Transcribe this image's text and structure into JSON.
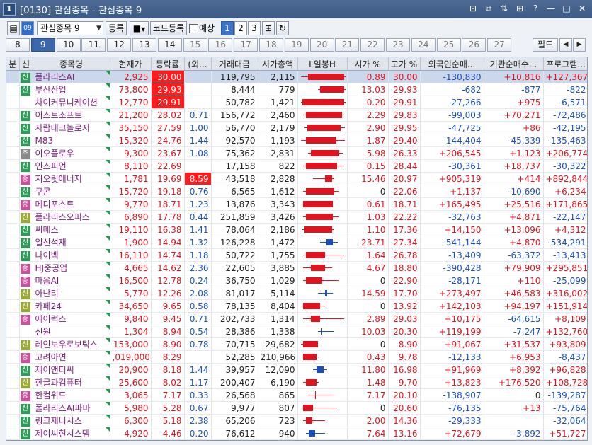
{
  "window": {
    "app_icon": "1",
    "title": "[0130] 관심종목 - 관심종목 9",
    "title_icons": [
      "link-icon",
      "copy-icon",
      "sort-icon",
      "grid-icon",
      "help-icon",
      "minimize-icon",
      "maximize-icon",
      "close-icon"
    ],
    "title_glyphs": [
      "⊡",
      "⧉",
      "⇅",
      "⊞",
      "?",
      "—",
      "□",
      "✕"
    ]
  },
  "toolbar": {
    "group_select": "관심종목 9",
    "register_btn": "등록",
    "code_register_btn": "코드등록",
    "forecast_label": "예상",
    "pages": [
      "1",
      "2",
      "3"
    ],
    "active_page": "1"
  },
  "tabs": {
    "items": [
      "8",
      "9",
      "10",
      "11",
      "12",
      "13",
      "14",
      "15",
      "16",
      "17",
      "18",
      "19",
      "20",
      "21",
      "22",
      "23",
      "24",
      "25",
      "26",
      "27"
    ],
    "active": "9",
    "dim_from": 7,
    "filter_btn": "필드",
    "prev": "◀",
    "next": "▶"
  },
  "headers": [
    "분",
    "신",
    "종목명",
    "현재가",
    "등락률",
    "(외...",
    "거래대금",
    "시가총액",
    "L일봉H",
    "시가 %",
    "고가 %",
    "외국인순매...",
    "기관순매수...",
    "프로그램..."
  ],
  "rows": [
    {
      "badge": "신",
      "bc": "b-green",
      "name": "폴라리스AI",
      "price": "2,925",
      "pc": "up",
      "rate": "30.00",
      "rc": "up",
      "rhl": true,
      "fr": "",
      "vol": "119,795",
      "cap": "2,115",
      "open": "0.89",
      "oc": "up",
      "high": "30.00",
      "hc": "up",
      "frg": "-130,830",
      "fc": "dn",
      "ins": "+10,816",
      "ic": "up",
      "prg": "+127,367",
      "gc": "up",
      "sel": true,
      "cdl": {
        "type": "up",
        "lo": 0.05,
        "o": 0.2,
        "c": 0.95,
        "hi": 0.98
      }
    },
    {
      "badge": "신",
      "bc": "b-green",
      "name": "부산산업",
      "price": "73,800",
      "pc": "up",
      "rate": "29.93",
      "rc": "up",
      "rhl": true,
      "fr": "",
      "vol": "8,444",
      "cap": "779",
      "open": "13.03",
      "oc": "up",
      "high": "29.93",
      "hc": "up",
      "frg": "-682",
      "fc": "dn",
      "ins": "-877",
      "ic": "dn",
      "prg": "-822",
      "gc": "dn",
      "cdl": {
        "type": "up",
        "lo": 0.4,
        "o": 0.45,
        "c": 0.95,
        "hi": 0.98
      }
    },
    {
      "badge": "",
      "bc": "",
      "name": "차이커뮤니케이션",
      "price": "12,770",
      "pc": "up",
      "rate": "29.91",
      "rc": "up",
      "rhl": true,
      "fr": "",
      "vol": "50,782",
      "cap": "1,421",
      "open": "0.20",
      "oc": "up",
      "high": "29.91",
      "hc": "up",
      "frg": "-27,266",
      "fc": "dn",
      "ins": "+975",
      "ic": "up",
      "prg": "-6,571",
      "gc": "dn",
      "cdl": {
        "type": "up",
        "lo": 0.05,
        "o": 0.08,
        "c": 0.95,
        "hi": 0.98
      }
    },
    {
      "badge": "신",
      "bc": "b-green",
      "name": "이스트소프트",
      "price": "21,200",
      "pc": "up",
      "rate": "28.02",
      "rc": "up",
      "fr": "0.71",
      "vol": "156,772",
      "cap": "2,460",
      "open": "2.29",
      "oc": "up",
      "high": "29.83",
      "hc": "up",
      "frg": "-99,003",
      "fc": "dn",
      "ins": "+70,271",
      "ic": "up",
      "prg": "-72,486",
      "gc": "dn",
      "cdl": {
        "type": "up",
        "lo": 0.1,
        "o": 0.15,
        "c": 0.9,
        "hi": 0.97
      }
    },
    {
      "badge": "신",
      "bc": "b-green",
      "name": "자람테크놀로지",
      "price": "35,150",
      "pc": "up",
      "rate": "27.59",
      "rc": "up",
      "fr": "1.00",
      "vol": "56,770",
      "cap": "2,179",
      "open": "2.90",
      "oc": "up",
      "high": "29.95",
      "hc": "up",
      "frg": "-47,725",
      "fc": "dn",
      "ins": "+86",
      "ic": "up",
      "prg": "-42,195",
      "gc": "dn",
      "cdl": {
        "type": "up",
        "lo": 0.12,
        "o": 0.18,
        "c": 0.88,
        "hi": 0.97
      }
    },
    {
      "badge": "신",
      "bc": "b-green",
      "name": "M83",
      "price": "15,320",
      "pc": "up",
      "rate": "24.76",
      "rc": "up",
      "fr": "1.44",
      "vol": "92,570",
      "cap": "1,193",
      "open": "1.87",
      "oc": "up",
      "high": "29.40",
      "hc": "up",
      "frg": "-144,404",
      "fc": "dn",
      "ins": "-45,339",
      "ic": "dn",
      "prg": "-135,463",
      "gc": "dn",
      "cdl": {
        "type": "up",
        "lo": 0.05,
        "o": 0.15,
        "c": 0.78,
        "hi": 0.96
      }
    },
    {
      "badge": "주",
      "bc": "b-gray",
      "name": "이오플로우",
      "price": "9,300",
      "pc": "up",
      "rate": "23.67",
      "rc": "up",
      "fr": "1.08",
      "vol": "75,362",
      "cap": "2,831",
      "open": "5.98",
      "oc": "up",
      "high": "26.33",
      "hc": "up",
      "frg": "+206,545",
      "fc": "up",
      "ins": "+1,123",
      "ic": "up",
      "prg": "+206,774",
      "gc": "up",
      "cdl": {
        "type": "up",
        "lo": 0.2,
        "o": 0.25,
        "c": 0.85,
        "hi": 0.92
      }
    },
    {
      "badge": "신",
      "bc": "b-green",
      "name": "인스피언",
      "price": "8,110",
      "pc": "up",
      "rate": "22.69",
      "rc": "up",
      "fr": "",
      "vol": "17,158",
      "cap": "822",
      "open": "0.15",
      "oc": "up",
      "high": "28.44",
      "hc": "up",
      "frg": "-30,361",
      "fc": "dn",
      "ins": "+18,737",
      "ic": "up",
      "prg": "-30,322",
      "gc": "dn",
      "cdl": {
        "type": "up",
        "lo": 0.1,
        "o": 0.15,
        "c": 0.8,
        "hi": 0.95
      }
    },
    {
      "badge": "증",
      "bc": "b-pink",
      "name": "지오릿에너지",
      "price": "1,781",
      "pc": "up",
      "rate": "19.69",
      "rc": "up",
      "fr": "8.59",
      "frhl": true,
      "vol": "43,518",
      "cap": "2,828",
      "open": "15.46",
      "oc": "up",
      "high": "20.97",
      "hc": "up",
      "frg": "+905,319",
      "fc": "up",
      "ins": "+414",
      "ic": "up",
      "prg": "+892,844",
      "gc": "up",
      "cdl": {
        "type": "up",
        "lo": 0.3,
        "o": 0.55,
        "c": 0.7,
        "hi": 0.75
      }
    },
    {
      "badge": "신",
      "bc": "b-green",
      "name": "쿠콘",
      "price": "15,720",
      "pc": "up",
      "rate": "19.18",
      "rc": "up",
      "fr": "0.76",
      "vol": "6,565",
      "cap": "1,612",
      "open": "0",
      "oc": "blk",
      "high": "22.06",
      "hc": "up",
      "frg": "+1,137",
      "fc": "up",
      "ins": "-10,690",
      "ic": "dn",
      "prg": "+6,234",
      "gc": "up",
      "cdl": {
        "type": "up",
        "lo": 0.1,
        "o": 0.15,
        "c": 0.75,
        "hi": 0.85
      }
    },
    {
      "badge": "증",
      "bc": "b-pink",
      "name": "메디포스트",
      "price": "9,770",
      "pc": "up",
      "rate": "18.71",
      "rc": "up",
      "fr": "1.23",
      "vol": "13,876",
      "cap": "3,343",
      "open": "0.61",
      "oc": "up",
      "high": "18.71",
      "hc": "up",
      "frg": "+165,495",
      "fc": "up",
      "ins": "+25,516",
      "ic": "up",
      "prg": "+171,865",
      "gc": "up",
      "cdl": {
        "type": "up",
        "lo": 0.05,
        "o": 0.1,
        "c": 0.72,
        "hi": 0.72
      }
    },
    {
      "badge": "신",
      "bc": "b-olive",
      "name": "폴라리스오피스",
      "price": "6,890",
      "pc": "up",
      "rate": "17.78",
      "rc": "up",
      "fr": "0.44",
      "vol": "251,859",
      "cap": "3,426",
      "open": "1.03",
      "oc": "up",
      "high": "22.22",
      "hc": "up",
      "frg": "-32,763",
      "fc": "dn",
      "ins": "+4,871",
      "ic": "up",
      "prg": "-22,147",
      "gc": "dn",
      "cdl": {
        "type": "up",
        "lo": 0.1,
        "o": 0.15,
        "c": 0.72,
        "hi": 0.85
      }
    },
    {
      "badge": "신",
      "bc": "b-green",
      "name": "씨메스",
      "price": "19,110",
      "pc": "up",
      "rate": "16.38",
      "rc": "up",
      "fr": "1.41",
      "vol": "78,064",
      "cap": "2,186",
      "open": "1.10",
      "oc": "up",
      "high": "17.36",
      "hc": "up",
      "frg": "+14,150",
      "fc": "up",
      "ins": "+13,096",
      "ic": "up",
      "prg": "+4,312",
      "gc": "up",
      "cdl": {
        "type": "up",
        "lo": 0.08,
        "o": 0.12,
        "c": 0.7,
        "hi": 0.75
      }
    },
    {
      "badge": "신",
      "bc": "b-green",
      "name": "일신석재",
      "price": "1,900",
      "pc": "up",
      "rate": "14.94",
      "rc": "up",
      "fr": "1.32",
      "vol": "126,228",
      "cap": "1,472",
      "open": "23.71",
      "oc": "up",
      "high": "27.34",
      "hc": "up",
      "frg": "-541,144",
      "fc": "dn",
      "ins": "+4,870",
      "ic": "up",
      "prg": "-534,291",
      "gc": "dn",
      "cdl": {
        "type": "dn",
        "lo": 0.45,
        "o": 0.72,
        "c": 0.58,
        "hi": 0.82
      }
    },
    {
      "badge": "신",
      "bc": "b-green",
      "name": "나이벡",
      "price": "16,110",
      "pc": "up",
      "rate": "14.74",
      "rc": "up",
      "fr": "1.18",
      "vol": "50,722",
      "cap": "1,755",
      "open": "1.64",
      "oc": "up",
      "high": "26.78",
      "hc": "up",
      "frg": "-13,409",
      "fc": "dn",
      "ins": "-63,372",
      "ic": "dn",
      "prg": "-13,413",
      "gc": "dn",
      "cdl": {
        "type": "up",
        "lo": 0.1,
        "o": 0.15,
        "c": 0.55,
        "hi": 0.95
      }
    },
    {
      "badge": "증",
      "bc": "b-pink",
      "name": "HJ중공업",
      "price": "4,665",
      "pc": "up",
      "rate": "14.62",
      "rc": "up",
      "fr": "2.36",
      "vol": "22,605",
      "cap": "3,885",
      "open": "4.67",
      "oc": "up",
      "high": "18.80",
      "hc": "up",
      "frg": "-390,428",
      "fc": "dn",
      "ins": "+79,909",
      "ic": "up",
      "prg": "+295,851",
      "gc": "up",
      "cdl": {
        "type": "up",
        "lo": 0.1,
        "o": 0.25,
        "c": 0.55,
        "hi": 0.7
      }
    },
    {
      "badge": "증",
      "bc": "b-pink",
      "name": "마음AI",
      "price": "16,500",
      "pc": "up",
      "rate": "12.78",
      "rc": "up",
      "fr": "0.24",
      "vol": "36,750",
      "cap": "1,029",
      "open": "0",
      "oc": "blk",
      "high": "22.90",
      "hc": "up",
      "frg": "-28,171",
      "fc": "dn",
      "ins": "+110",
      "ic": "up",
      "prg": "-25,099",
      "gc": "dn",
      "cdl": {
        "type": "up",
        "lo": 0.1,
        "o": 0.15,
        "c": 0.5,
        "hi": 0.85
      }
    },
    {
      "badge": "신",
      "bc": "b-olive",
      "name": "아난티",
      "price": "5,770",
      "pc": "up",
      "rate": "12.26",
      "rc": "up",
      "fr": "2.08",
      "vol": "81,017",
      "cap": "5,114",
      "open": "14.59",
      "oc": "up",
      "high": "17.70",
      "hc": "up",
      "frg": "+273,497",
      "fc": "up",
      "ins": "+46,583",
      "ic": "up",
      "prg": "+316,002",
      "gc": "up",
      "cdl": {
        "type": "dn",
        "lo": 0.4,
        "o": 0.6,
        "c": 0.55,
        "hi": 0.72
      }
    },
    {
      "badge": "신",
      "bc": "b-olive",
      "name": "카페24",
      "price": "34,650",
      "pc": "up",
      "rate": "9.65",
      "rc": "up",
      "fr": "0.58",
      "vol": "78,135",
      "cap": "8,404",
      "open": "0",
      "oc": "blk",
      "high": "13.92",
      "hc": "up",
      "frg": "+142,103",
      "fc": "up",
      "ins": "+94,197",
      "ic": "up",
      "prg": "+151,914",
      "gc": "up",
      "cdl": {
        "type": "up",
        "lo": 0.05,
        "o": 0.1,
        "c": 0.45,
        "hi": 0.55
      }
    },
    {
      "badge": "증",
      "bc": "b-pink",
      "name": "에이럭스",
      "price": "9,840",
      "pc": "up",
      "rate": "9.45",
      "rc": "up",
      "fr": "0.71",
      "vol": "202,733",
      "cap": "1,314",
      "open": "2.89",
      "oc": "up",
      "high": "29.03",
      "hc": "up",
      "frg": "+10,175",
      "fc": "up",
      "ins": "-64,615",
      "ic": "dn",
      "prg": "+8,109",
      "gc": "up",
      "cdl": {
        "type": "up",
        "lo": 0.1,
        "o": 0.25,
        "c": 0.45,
        "hi": 0.95
      }
    },
    {
      "badge": "",
      "bc": "",
      "name": "신원",
      "price": "1,304",
      "pc": "up",
      "rate": "8.94",
      "rc": "up",
      "fr": "0.54",
      "vol": "28,386",
      "cap": "1,338",
      "open": "10.03",
      "oc": "up",
      "high": "20.30",
      "hc": "up",
      "frg": "+119,199",
      "fc": "up",
      "ins": "-7,247",
      "ic": "dn",
      "prg": "+132,760",
      "gc": "up",
      "cdl": {
        "type": "dn",
        "lo": 0.4,
        "o": 0.5,
        "c": 0.48,
        "hi": 0.75
      }
    },
    {
      "badge": "신",
      "bc": "b-olive",
      "name": "레인보우로보틱스",
      "price": "153,000",
      "pc": "up",
      "rate": "8.90",
      "rc": "up",
      "fr": "0.78",
      "vol": "70,715",
      "cap": "29,682",
      "open": "0",
      "oc": "blk",
      "high": "8.90",
      "hc": "up",
      "frg": "+91,067",
      "fc": "up",
      "ins": "+31,537",
      "ic": "up",
      "prg": "+93,809",
      "gc": "up",
      "cdl": {
        "type": "up",
        "lo": 0.05,
        "o": 0.1,
        "c": 0.4,
        "hi": 0.4
      }
    },
    {
      "badge": "증",
      "bc": "b-pink",
      "name": "고려아연",
      "price": ",019,000",
      "pc": "up",
      "rate": "8.29",
      "rc": "up",
      "fr": "",
      "vol": "52,285",
      "cap": "210,966",
      "open": "0.43",
      "oc": "up",
      "high": "9.78",
      "hc": "up",
      "frg": "-12,133",
      "fc": "dn",
      "ins": "+6,953",
      "ic": "up",
      "prg": "-8,437",
      "gc": "dn",
      "cdl": {
        "type": "up",
        "lo": 0.05,
        "o": 0.1,
        "c": 0.38,
        "hi": 0.42
      }
    },
    {
      "badge": "신",
      "bc": "b-green",
      "name": "제이앤티씨",
      "price": "20,900",
      "pc": "up",
      "rate": "8.18",
      "rc": "up",
      "fr": "1.44",
      "vol": "39,957",
      "cap": "12,090",
      "open": "11.80",
      "oc": "up",
      "high": "16.98",
      "hc": "up",
      "frg": "+91,969",
      "fc": "up",
      "ins": "+8,392",
      "ic": "up",
      "prg": "+96,828",
      "gc": "up",
      "cdl": {
        "type": "dn",
        "lo": 0.3,
        "o": 0.52,
        "c": 0.38,
        "hi": 0.6
      }
    },
    {
      "badge": "신",
      "bc": "b-olive",
      "name": "한글과컴퓨터",
      "price": "25,600",
      "pc": "up",
      "rate": "8.02",
      "rc": "up",
      "fr": "1.17",
      "vol": "200,407",
      "cap": "6,190",
      "open": "1.48",
      "oc": "up",
      "high": "9.70",
      "hc": "up",
      "frg": "+13,823",
      "fc": "up",
      "ins": "+176,520",
      "ic": "up",
      "prg": "+108,728",
      "gc": "up",
      "cdl": {
        "type": "up",
        "lo": 0.1,
        "o": 0.15,
        "c": 0.38,
        "hi": 0.42
      }
    },
    {
      "badge": "증",
      "bc": "b-pink",
      "name": "한컴위드",
      "price": "3,065",
      "pc": "up",
      "rate": "7.17",
      "rc": "up",
      "fr": "0.33",
      "vol": "26,568",
      "cap": "865",
      "open": "7.17",
      "oc": "up",
      "high": "20.10",
      "hc": "up",
      "frg": "-138,907",
      "fc": "dn",
      "ins": "0",
      "ic": "blk",
      "prg": "-139,287",
      "gc": "dn",
      "cdl": {
        "type": "flat",
        "lo": 0.2,
        "o": 0.35,
        "c": 0.35,
        "hi": 0.75
      }
    },
    {
      "badge": "신",
      "bc": "b-green",
      "name": "폴라리스AI파마",
      "price": "5,980",
      "pc": "up",
      "rate": "5.28",
      "rc": "up",
      "fr": "0.67",
      "vol": "9,977",
      "cap": "807",
      "open": "0",
      "oc": "blk",
      "high": "20.60",
      "hc": "up",
      "frg": "-76,135",
      "fc": "dn",
      "ins": "+13",
      "ic": "up",
      "prg": "-75,764",
      "gc": "dn",
      "cdl": {
        "type": "up",
        "lo": 0.05,
        "o": 0.1,
        "c": 0.3,
        "hi": 0.8
      }
    },
    {
      "badge": "신",
      "bc": "b-green",
      "name": "링크제니시스",
      "price": "6,300",
      "pc": "up",
      "rate": "5.18",
      "rc": "up",
      "fr": "2.38",
      "vol": "65,206",
      "cap": "723",
      "open": "2.00",
      "oc": "up",
      "high": "14.36",
      "hc": "up",
      "frg": "-29,333",
      "fc": "dn",
      "ins": "",
      "ic": "blk",
      "prg": "-32,064",
      "gc": "dn",
      "cdl": {
        "type": "up",
        "lo": 0.1,
        "o": 0.15,
        "c": 0.28,
        "hi": 0.55
      }
    },
    {
      "badge": "신",
      "bc": "b-green",
      "name": "제이씨현시스템",
      "price": "4,920",
      "pc": "up",
      "rate": "4.46",
      "rc": "up",
      "fr": "0.20",
      "vol": "76,612",
      "cap": "940",
      "open": "7.64",
      "oc": "up",
      "high": "13.16",
      "hc": "up",
      "frg": "+72,679",
      "fc": "up",
      "ins": "-3,892",
      "ic": "dn",
      "prg": "+51,727",
      "gc": "up",
      "cdl": {
        "type": "dn",
        "lo": 0.15,
        "o": 0.35,
        "c": 0.22,
        "hi": 0.55
      }
    }
  ],
  "colors": {
    "up": "#e0141e",
    "down": "#1a4fbf",
    "highlight": "#ff1b1b",
    "selected_row": "#cbd7ea"
  }
}
